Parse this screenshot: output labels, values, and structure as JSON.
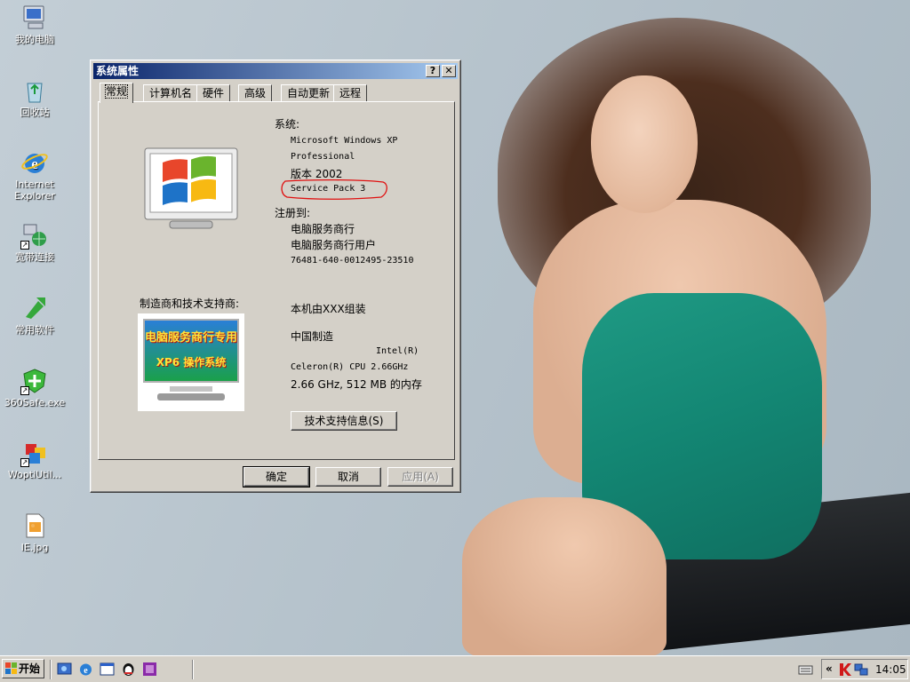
{
  "desktop": {
    "icons": [
      {
        "label": "我的电脑",
        "icon": "my-computer-icon"
      },
      {
        "label": "回收站",
        "icon": "recycle-bin-icon"
      },
      {
        "label": "Internet Explorer",
        "icon": "internet-explorer-icon"
      },
      {
        "label": "宽带连接",
        "icon": "broadband-connection-icon"
      },
      {
        "label": "常用软件",
        "icon": "common-software-icon"
      },
      {
        "label": "360Safe.exe",
        "icon": "360safe-icon"
      },
      {
        "label": "WoptiUtil...",
        "icon": "woptiutilities-icon"
      },
      {
        "label": "IE.jpg",
        "icon": "image-file-icon"
      }
    ]
  },
  "window": {
    "title": "系统属性",
    "help_glyph": "?",
    "close_glyph": "✕",
    "tabs": [
      {
        "label": "常规",
        "active": true
      },
      {
        "label": "计算机名",
        "active": false
      },
      {
        "label": "硬件",
        "active": false
      },
      {
        "label": "高级",
        "active": false
      },
      {
        "label": "自动更新",
        "active": false
      },
      {
        "label": "远程",
        "active": false
      }
    ],
    "general": {
      "system_heading": "系统:",
      "os_name_1": "Microsoft Windows XP",
      "os_name_2": "Professional",
      "version": "版本 2002",
      "service_pack": "Service Pack 3",
      "registered_heading": "注册到:",
      "registered_owner": "电脑服务商行",
      "registered_user": "电脑服务商行用户",
      "product_id": "76481-640-0012495-23510",
      "manufacturer_heading": "制造商和技术支持商:",
      "oem_logo_line1": "电脑服务商行专用",
      "oem_logo_line2": "XP6 操作系统",
      "assembled_by": "本机由XXX组装",
      "made_in": "中国制造",
      "cpu_vendor": "Intel(R)",
      "cpu_model": "Celeron(R) CPU 2.66GHz",
      "cpu_memory": "2.66 GHz, 512 MB 的内存",
      "support_button": "技术支持信息(S)"
    },
    "buttons": {
      "ok": "确定",
      "cancel": "取消",
      "apply": "应用(A)"
    }
  },
  "taskbar": {
    "start_label": "开始",
    "clock": "14:05",
    "tray_expand": "«",
    "colors": {
      "title_start": "#0a246a",
      "title_end": "#a6caf0",
      "face": "#d4d0c8"
    }
  }
}
